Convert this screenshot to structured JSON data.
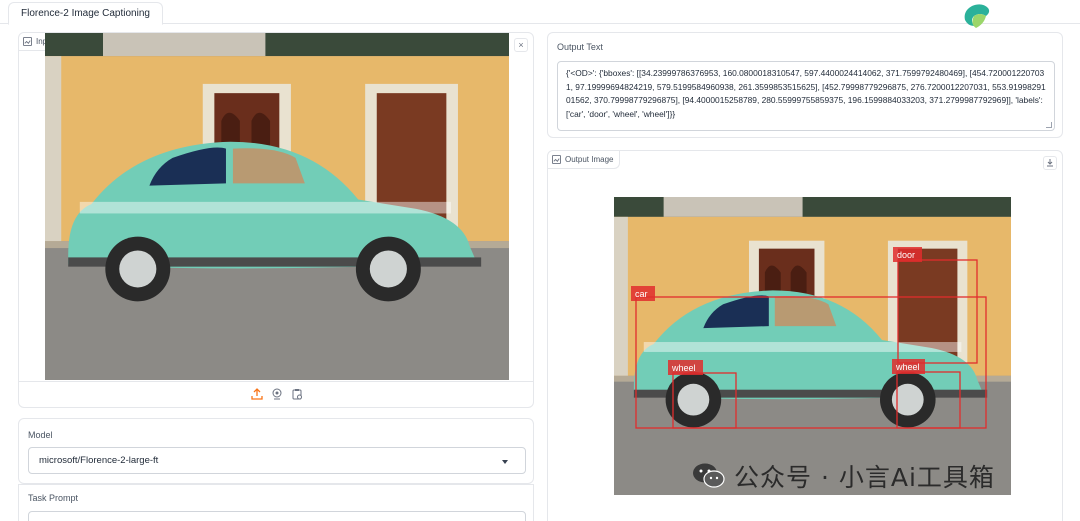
{
  "tabs": [
    {
      "label": "Florence-2 Image Captioning"
    }
  ],
  "input_panel": {
    "label": "Input Picture",
    "clear_glyph": "×"
  },
  "output_text": {
    "label": "Output Text",
    "value": "{'<OD>': {'bboxes': [[34.23999786376953, 160.0800018310547, 597.4400024414062, 371.7599792480469], [454.7200012207031, 97.19999694824219, 579.5199584960938, 261.3599853515625], [452.79998779296875, 276.7200012207031, 553.9199829101562, 370.79998779296875], [94.4000015258789, 280.55999755859375, 196.1599884033203, 371.2799987792969]], 'labels': ['car', 'door', 'wheel', 'wheel']}}"
  },
  "output_image": {
    "label": "Output Image",
    "detections": [
      {
        "label": "car"
      },
      {
        "label": "door"
      },
      {
        "label": "wheel"
      },
      {
        "label": "wheel"
      }
    ],
    "box_color": "#e12d2d"
  },
  "model": {
    "label": "Model",
    "selected": "microsoft/Florence-2-large-ft"
  },
  "task_prompt": {
    "label": "Task Prompt"
  },
  "watermark": {
    "text": "公众号 · 小言Ai工具箱"
  },
  "icons": {
    "upload": "upload-icon",
    "webcam": "webcam-icon",
    "clipboard": "clipboard-icon",
    "download": "download-icon",
    "logo": "florence-logo"
  }
}
